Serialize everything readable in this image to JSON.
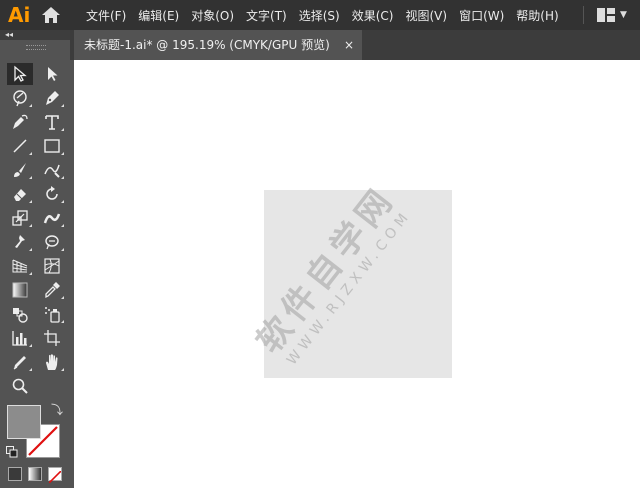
{
  "app": {
    "logo": "Ai"
  },
  "menu": [
    {
      "label": "文件(F)"
    },
    {
      "label": "编辑(E)"
    },
    {
      "label": "对象(O)"
    },
    {
      "label": "文字(T)"
    },
    {
      "label": "选择(S)"
    },
    {
      "label": "效果(C)"
    },
    {
      "label": "视图(V)"
    },
    {
      "label": "窗口(W)"
    },
    {
      "label": "帮助(H)"
    }
  ],
  "document": {
    "tab_label": "未标题-1.ai* @ 195.19% (CMYK/GPU 预览)",
    "close_glyph": "×"
  },
  "toolbar": {
    "collapse_glyph": "◂◂",
    "tools": [
      "selection-tool-icon",
      "direct-selection-tool-icon",
      "magic-wand-tool-icon",
      "pen-tool-icon",
      "curvature-tool-icon",
      "type-tool-icon",
      "line-segment-tool-icon",
      "rectangle-tool-icon",
      "paintbrush-tool-icon",
      "shaper-tool-icon",
      "eraser-tool-icon",
      "rotate-tool-icon",
      "scale-tool-icon",
      "width-tool-icon",
      "puppet-warp-tool-icon",
      "free-transform-tool-icon",
      "perspective-grid-tool-icon",
      "mesh-tool-icon",
      "gradient-tool-icon",
      "eyedropper-tool-icon",
      "blend-tool-icon",
      "symbol-sprayer-tool-icon",
      "column-graph-tool-icon",
      "artboard-tool-icon",
      "slice-tool-icon",
      "hand-tool-icon",
      "zoom-tool-icon"
    ],
    "fill_color": "#8c8c8c",
    "stroke_color": "none"
  },
  "canvas": {
    "background": "#ffffff",
    "shape_fill": "#e6e6e6"
  },
  "watermark": {
    "main": "软件自学网",
    "sub": "WWW.RJZXW.COM"
  }
}
